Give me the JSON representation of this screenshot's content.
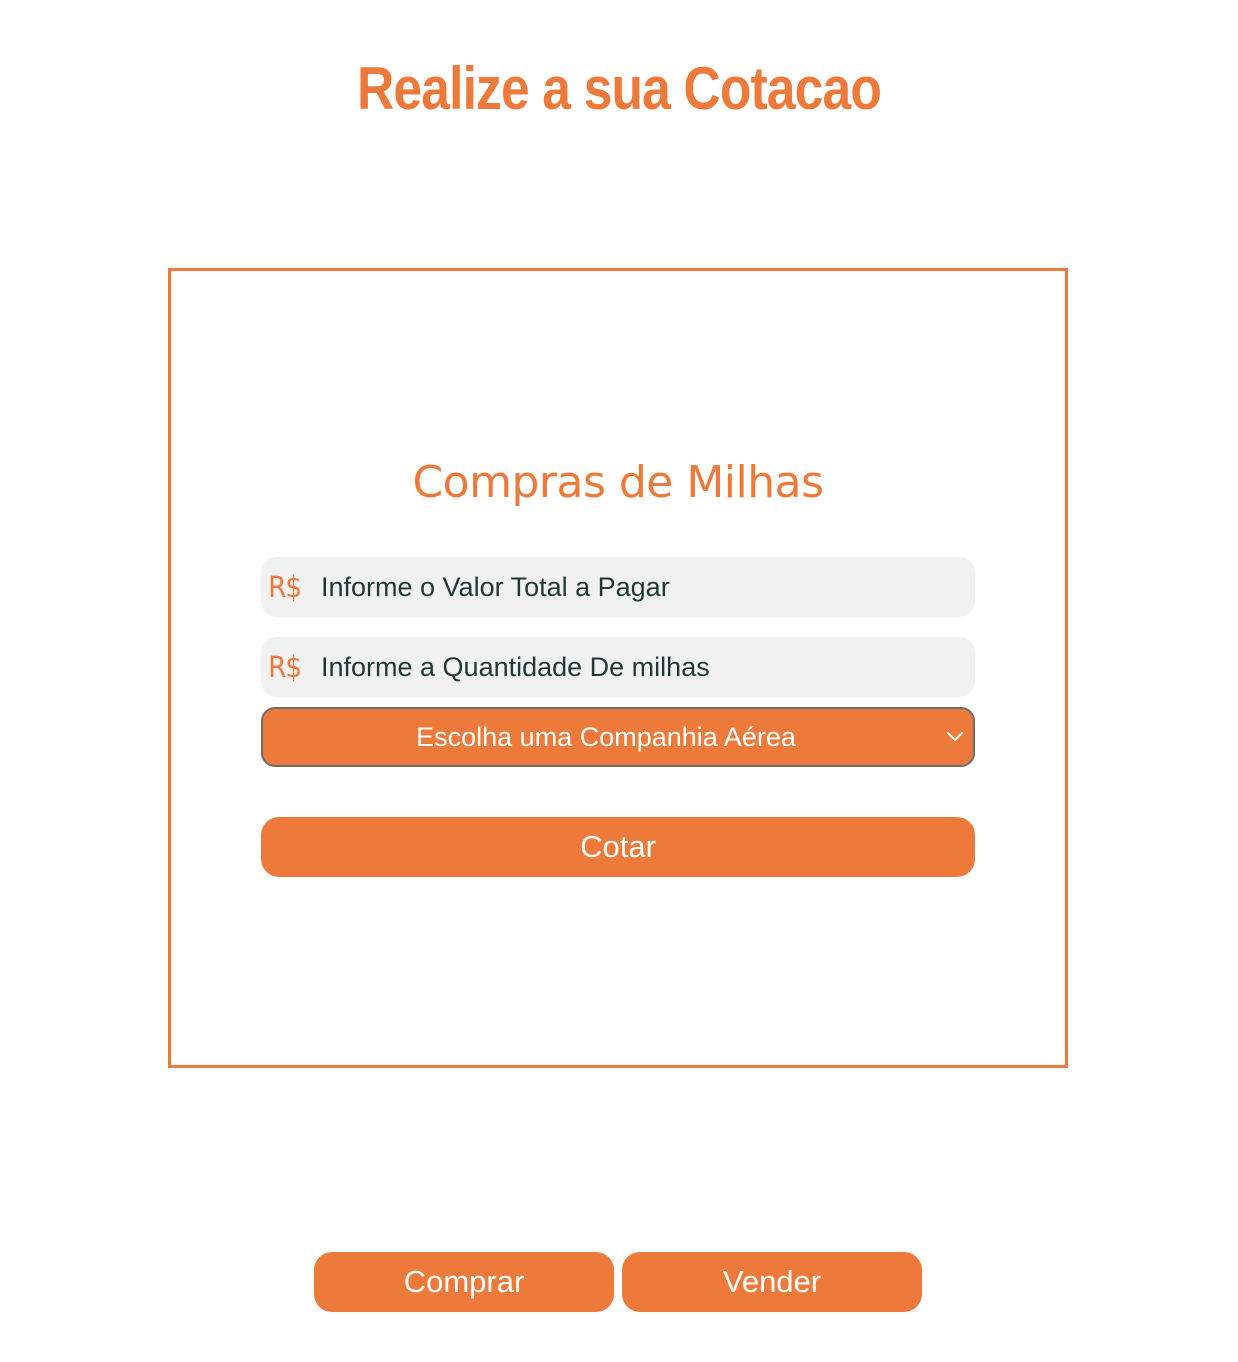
{
  "page": {
    "title": "Realize a sua Cotacao"
  },
  "form": {
    "title": "Compras de Milhas",
    "currency_symbol": "R$",
    "currency_icon": "brl-currency-icon",
    "total_value_placeholder": "Informe o Valor Total a Pagar",
    "miles_quantity_placeholder": "Informe a Quantidade De milhas",
    "airline_select_label": "Escolha uma Companhia Aérea",
    "select_icon": "chevron-down-icon",
    "submit_label": "Cotar"
  },
  "mode_buttons": {
    "buy_label": "Comprar",
    "sell_label": "Vender"
  },
  "colors": {
    "accent": "#ed7a3a",
    "field_background": "#f1f1f1",
    "field_text": "#1f3a34",
    "button_text": "#ffffff"
  }
}
